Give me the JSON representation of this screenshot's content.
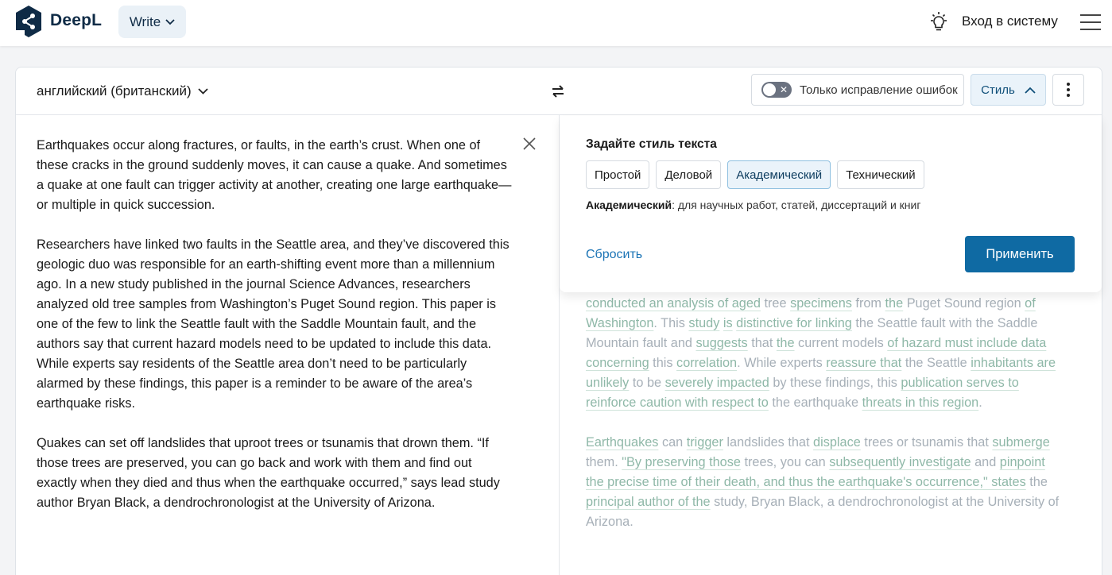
{
  "header": {
    "brand": "DeepL",
    "write_label": "Write",
    "login_label": "Вход в систему"
  },
  "toolbar": {
    "source_language": "английский (британский)",
    "correction_only_label": "Только исправление ошибок",
    "style_label": "Стиль"
  },
  "source": {
    "paragraphs": [
      "Earthquakes occur along fractures, or faults, in the earth’s crust. When one of these cracks in the ground suddenly moves, it can cause a quake. And sometimes a quake at one fault can trigger activity at another, creating one large earthquake—or multiple in quick succession.",
      "Researchers have linked two faults in the Seattle area, and they’ve discovered this geologic duo was responsible for an earth-shifting event more than a millennium ago. In a new study published in the journal Science Advances, researchers analyzed old tree samples from Washington’s Puget Sound region. This paper is one of the few to link the Seattle fault with the Saddle Mountain fault, and the authors say that current hazard models need to be updated to include this data. While experts say residents of the Seattle area don’t need to be particularly alarmed by these findings, this paper is a reminder to be aware of the area’s earthquake risks.",
      "Quakes can set off landslides that uproot trees or tsunamis that drown them. “If those trees are preserved, you can go back and work with them and find out exactly when they died and thus when the earthquake occurred,” says lead study author Bryan Black, a dendrochronologist at the University of Arizona."
    ]
  },
  "style_popover": {
    "title": "Задайте стиль текста",
    "options": [
      "Простой",
      "Деловой",
      "Академический",
      "Технический"
    ],
    "selected": "Академический",
    "description_term": "Академический",
    "description_text": ": для научных работ, статей, диссертаций и книг",
    "reset_label": "Сбросить",
    "apply_label": "Применить"
  },
  "target": {
    "p1": [
      {
        "t": "conducted an analysis of aged",
        "h": true
      },
      {
        "t": " tree "
      },
      {
        "t": "specimens",
        "h": true
      },
      {
        "t": " from "
      },
      {
        "t": "the",
        "h": true
      },
      {
        "t": " Puget Sound region "
      },
      {
        "t": "of Washington",
        "h": true
      },
      {
        "t": ". This "
      },
      {
        "t": "study",
        "h": true
      },
      {
        "t": " "
      },
      {
        "t": "is",
        "h": true
      },
      {
        "t": " "
      },
      {
        "t": "distinctive for linking",
        "h": true
      },
      {
        "t": " the Seattle fault with the Saddle Mountain fault and "
      },
      {
        "t": "suggests",
        "h": true
      },
      {
        "t": " that "
      },
      {
        "t": "the",
        "h": true
      },
      {
        "t": " current models "
      },
      {
        "t": "of hazard must include data concerning",
        "h": true
      },
      {
        "t": " this "
      },
      {
        "t": "correlation",
        "h": true
      },
      {
        "t": ". While experts "
      },
      {
        "t": "reassure that",
        "h": true
      },
      {
        "t": " the Seattle "
      },
      {
        "t": "inhabitants are unlikely",
        "h": true
      },
      {
        "t": " to be "
      },
      {
        "t": "severely impacted",
        "h": true
      },
      {
        "t": " by these findings, this "
      },
      {
        "t": "publication serves to reinforce caution with respect to",
        "h": true
      },
      {
        "t": " the earthquake "
      },
      {
        "t": "threats in this region",
        "h": true
      },
      {
        "t": "."
      }
    ],
    "p2": [
      {
        "t": "Earthquakes",
        "h": true
      },
      {
        "t": " can "
      },
      {
        "t": "trigger",
        "h": true
      },
      {
        "t": " landslides that "
      },
      {
        "t": "displace",
        "h": true
      },
      {
        "t": " trees or tsunamis that "
      },
      {
        "t": "submerge",
        "h": true
      },
      {
        "t": " them. "
      },
      {
        "t": "\"By preserving those",
        "h": true
      },
      {
        "t": " trees, you can "
      },
      {
        "t": "subsequently investigate",
        "h": true
      },
      {
        "t": " and "
      },
      {
        "t": "pinpoint the precise time of their death, and thus the earthquake's occurrence,\" states",
        "h": true
      },
      {
        "t": " the "
      },
      {
        "t": "principal author of the",
        "h": true
      },
      {
        "t": " study, Bryan Black, a dendrochronologist at the University of Arizona."
      }
    ]
  }
}
